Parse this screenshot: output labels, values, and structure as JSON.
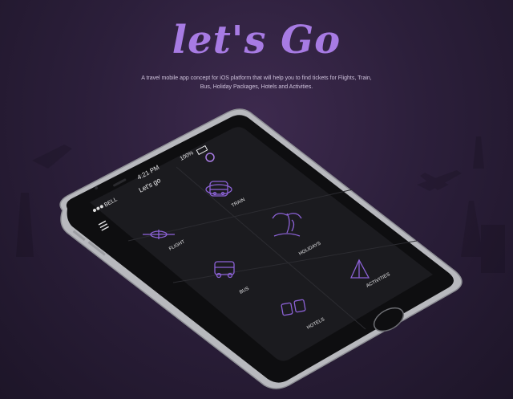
{
  "hero": {
    "title": "let's Go",
    "subtitle_line1": "A travel mobile app concept for iOS platform that will help you to find tickets for Flights, Train,",
    "subtitle_line2": "Bus, Holiday Packages, Hotels and Activities."
  },
  "status_bar": {
    "carrier": "BELL",
    "time": "4:21 PM",
    "battery": "100%"
  },
  "app_header": {
    "title": "Let's go"
  },
  "categories": [
    {
      "label": "TRAIN",
      "icon": "train-icon"
    },
    {
      "label": "FLIGHT",
      "icon": "airplane-icon"
    },
    {
      "label": "HOLIDAYS",
      "icon": "palm-tree-icon"
    },
    {
      "label": "BUS",
      "icon": "bus-icon"
    },
    {
      "label": "ACTIVITIES",
      "icon": "tent-icon"
    },
    {
      "label": "HOTELS",
      "icon": "bed-icon"
    }
  ],
  "colors": {
    "accent": "#a77be3",
    "icon_stroke": "#8c62d6",
    "screen_bg": "#1b1b1f",
    "background": "#2c1f3b"
  }
}
